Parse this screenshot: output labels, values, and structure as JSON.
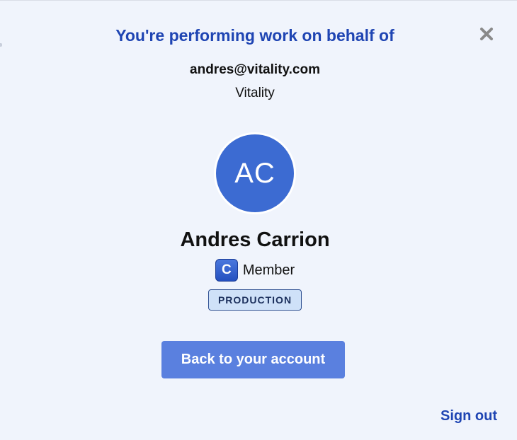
{
  "dialog": {
    "title": "You're performing work on behalf of",
    "close_icon": "close-icon"
  },
  "account": {
    "email": "andres@vitality.com",
    "organization": "Vitality"
  },
  "user": {
    "initials": "AC",
    "name": "Andres Carrion",
    "role_badge_letter": "C",
    "role": "Member",
    "environment": "PRODUCTION"
  },
  "actions": {
    "back_label": "Back to your account",
    "sign_out_label": "Sign out"
  },
  "colors": {
    "accent": "#1f45b3",
    "avatar_bg": "#3c6bd2",
    "button_bg": "#5a80df",
    "badge_bg": "#cfe1f8",
    "panel_bg": "#f0f4fc"
  }
}
